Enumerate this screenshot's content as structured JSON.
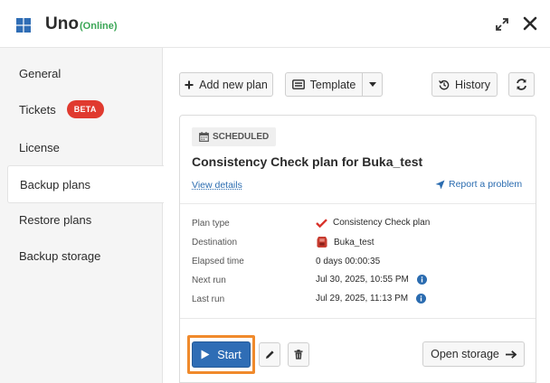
{
  "header": {
    "title": "Uno",
    "status": "(Online)",
    "status_color": "#3aa655",
    "icons": [
      "windows-logo-icon",
      "expand-icon",
      "close-icon"
    ]
  },
  "sidebar": {
    "items": [
      {
        "label": "General",
        "active": false
      },
      {
        "label": "Tickets",
        "active": false,
        "badge": "BETA"
      },
      {
        "label": "License",
        "active": false
      },
      {
        "label": "Backup plans",
        "active": true
      },
      {
        "label": "Restore plans",
        "active": false
      },
      {
        "label": "Backup storage",
        "active": false
      }
    ]
  },
  "toolbar": {
    "add_new_plan": "Add new plan",
    "template": "Template",
    "history": "History"
  },
  "plan": {
    "badge": "SCHEDULED",
    "name": "Consistency Check plan for Buka_test",
    "view_details": "View details",
    "report_problem": "Report a problem",
    "details": {
      "plan_type_label": "Plan type",
      "plan_type_value": "Consistency Check plan",
      "destination_label": "Destination",
      "destination_value": "Buka_test",
      "elapsed_label": "Elapsed time",
      "elapsed_value": "0 days 00:00:35",
      "next_run_label": "Next run",
      "next_run_value": "Jul 30, 2025, 10:55 PM",
      "last_run_label": "Last run",
      "last_run_value": "Jul 29, 2025, 11:13 PM"
    },
    "actions": {
      "start": "Start",
      "open_storage": "Open storage"
    }
  },
  "colors": {
    "accent": "#2f6db5",
    "highlight_outline": "#f08a2c",
    "beta_badge": "#e03a2f",
    "check": "#d9332b",
    "link": "#2b6cb0"
  }
}
